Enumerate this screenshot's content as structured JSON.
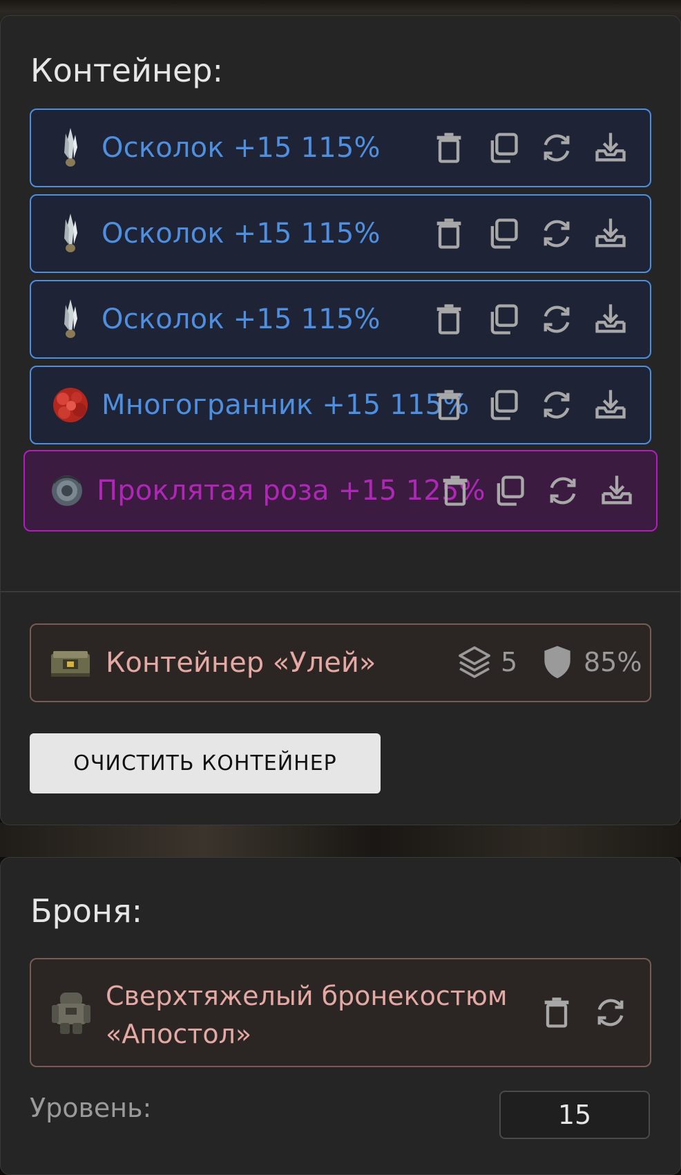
{
  "container_section": {
    "title": "Контейнер:",
    "items": [
      {
        "name": "Осколок +15 115%",
        "rarity": "blue",
        "icon": "crystal-shard-icon"
      },
      {
        "name": "Осколок +15 115%",
        "rarity": "blue",
        "icon": "crystal-shard-icon"
      },
      {
        "name": "Осколок +15 115%",
        "rarity": "blue",
        "icon": "crystal-shard-icon"
      },
      {
        "name": "Многогранник +15 115%",
        "rarity": "blue",
        "icon": "polyhedron-icon"
      },
      {
        "name": "Проклятая роза +15 125%",
        "rarity": "purple",
        "icon": "cursed-rose-icon"
      }
    ],
    "container": {
      "name": "Контейнер «Улей»",
      "slots": "5",
      "protection": "85%"
    },
    "clear_button": "ОЧИСТИТЬ КОНТЕЙНЕР"
  },
  "armor_section": {
    "title": "Броня:",
    "armor_name": "Сверхтяжелый бронекостюм «Апостол»",
    "level_label": "Уровень:",
    "level_value": "15"
  },
  "colors": {
    "blue_border": "#4a8fe6",
    "blue_text": "#4f8fe0",
    "purple_border": "#b41cc0",
    "purple_text": "#b027b8",
    "armor_text": "#e5a9a4"
  }
}
